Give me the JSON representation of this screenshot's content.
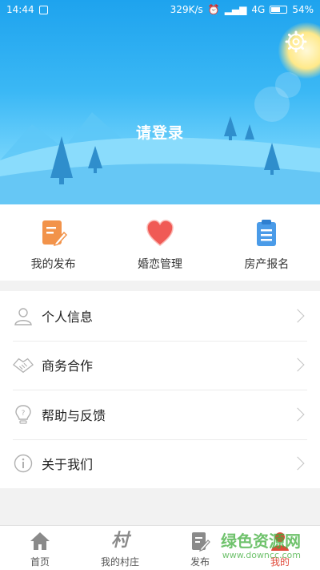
{
  "status_bar": {
    "time": "14:44",
    "net_speed": "329K/s",
    "network": "4G",
    "battery": "54%"
  },
  "header": {
    "login_text": "请登录"
  },
  "quick_actions": [
    {
      "label": "我的发布",
      "icon": "edit-doc-icon"
    },
    {
      "label": "婚恋管理",
      "icon": "heart-icon"
    },
    {
      "label": "房产报名",
      "icon": "clipboard-icon"
    }
  ],
  "menu": [
    {
      "label": "个人信息",
      "icon": "user-icon"
    },
    {
      "label": "商务合作",
      "icon": "handshake-icon"
    },
    {
      "label": "帮助与反馈",
      "icon": "help-bulb-icon"
    },
    {
      "label": "关于我们",
      "icon": "info-icon"
    }
  ],
  "tabs": [
    {
      "label": "首页",
      "icon": "home-icon"
    },
    {
      "label": "我的村庄",
      "icon": "village-icon",
      "glyph": "村"
    },
    {
      "label": "发布",
      "icon": "publish-icon"
    },
    {
      "label": "我的",
      "icon": "profile-icon",
      "active": true
    }
  ],
  "watermark": {
    "title": "绿色资源网",
    "url": "www.downcc.com"
  },
  "colors": {
    "header_top": "#1ea3ee",
    "header_bottom": "#a9e8ff",
    "accent_red": "#e04a3a",
    "orange": "#f2934a",
    "heart": "#f05a55",
    "blue": "#4a9be8"
  }
}
